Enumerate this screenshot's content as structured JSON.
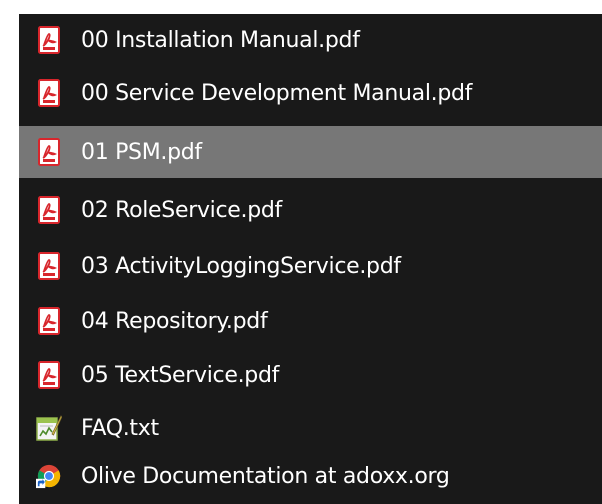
{
  "start_menu_folder": {
    "items": [
      {
        "label": "00 Installation Manual.pdf",
        "icon": "pdf-file-icon",
        "selected": false
      },
      {
        "label": "00 Service Development Manual.pdf",
        "icon": "pdf-file-icon",
        "selected": false
      },
      {
        "label": "01 PSM.pdf",
        "icon": "pdf-file-icon",
        "selected": true
      },
      {
        "label": "02 RoleService.pdf",
        "icon": "pdf-file-icon",
        "selected": false
      },
      {
        "label": "03 ActivityLoggingService.pdf",
        "icon": "pdf-file-icon",
        "selected": false
      },
      {
        "label": "04 Repository.pdf",
        "icon": "pdf-file-icon",
        "selected": false
      },
      {
        "label": "05 TextService.pdf",
        "icon": "pdf-file-icon",
        "selected": false
      },
      {
        "label": "FAQ.txt",
        "icon": "text-file-icon",
        "selected": false
      },
      {
        "label": "Olive Documentation at adoxx.org",
        "icon": "chrome-shortcut-icon",
        "selected": false
      }
    ]
  },
  "colors": {
    "list_background": "#191919",
    "selected_background": "#777777",
    "text": "#ffffff",
    "pdf_red": "#d8262c"
  }
}
